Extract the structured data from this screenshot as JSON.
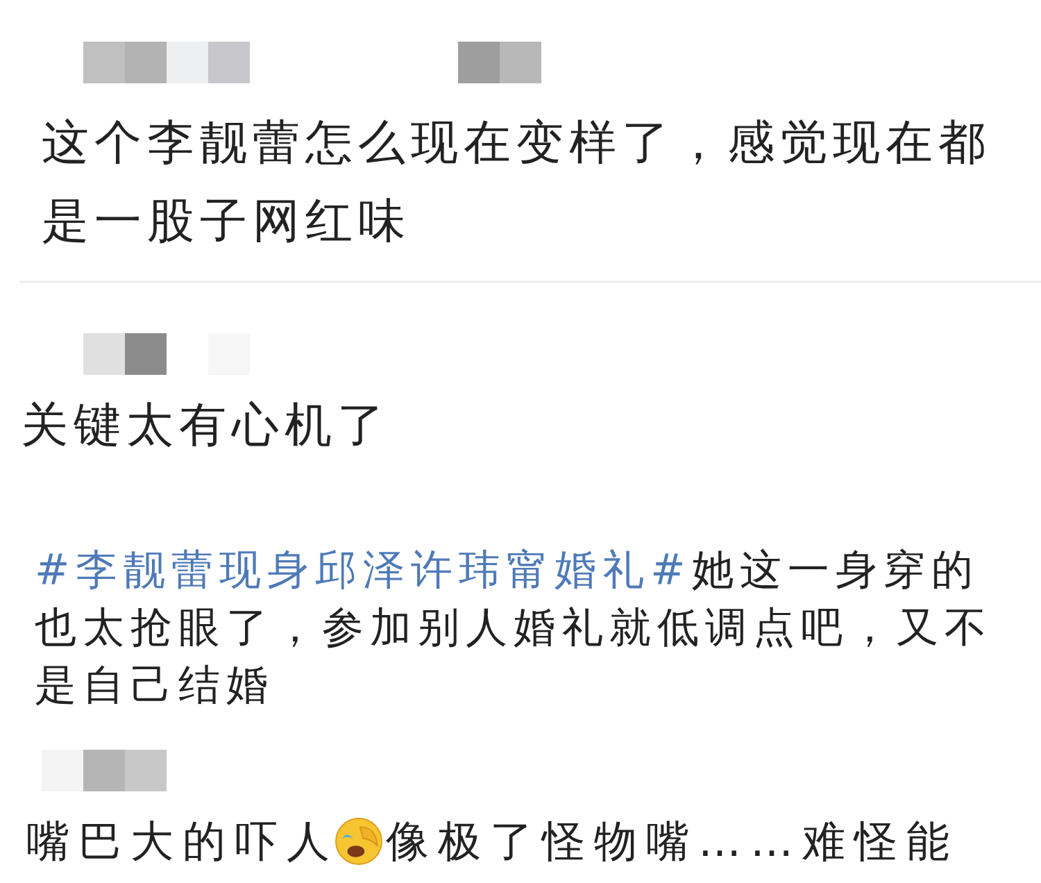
{
  "comments": [
    {
      "text": "这个李靓蕾怎么现在变样了，感觉现在都是一股子网红味"
    },
    {
      "text": "关键太有心机了"
    },
    {
      "hashtag": "#李靓蕾现身邱泽许玮甯婚礼#",
      "text": "她这一身穿的也太抢眼了，参加别人婚礼就低调点吧，又不是自己结婚"
    },
    {
      "text": "嘴巴大的吓人",
      "emoji": true,
      "text_after": "像极了怪物嘴……难怪能"
    }
  ]
}
